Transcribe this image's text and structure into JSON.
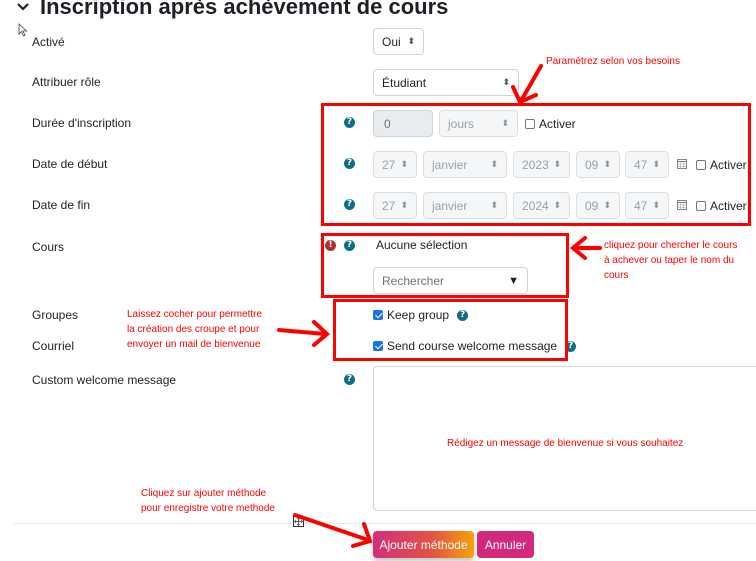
{
  "section": {
    "title": "Inscription après achèvement de cours",
    "collapse_icon": "chevron-down-icon"
  },
  "fields": {
    "enabled": {
      "label": "Activé",
      "value": "Oui"
    },
    "role": {
      "label": "Attribuer rôle",
      "value": "Étudiant"
    },
    "duration": {
      "label": "Durée d'inscription",
      "value": "0",
      "unit": "jours",
      "enable_label": "Activer",
      "enabled": false
    },
    "start_date": {
      "label": "Date de début",
      "day": "27",
      "month": "janvier",
      "year": "2023",
      "hour": "09",
      "minute": "47",
      "enable_label": "Activer",
      "enabled": false
    },
    "end_date": {
      "label": "Date de fin",
      "day": "27",
      "month": "janvier",
      "year": "2024",
      "hour": "09",
      "minute": "47",
      "enable_label": "Activer",
      "enabled": false
    },
    "course": {
      "label": "Cours",
      "selection": "Aucune sélection",
      "search_placeholder": "Rechercher",
      "required": true
    },
    "groups": {
      "label": "Groupes",
      "checkbox_label": "Keep group",
      "checked": true
    },
    "email": {
      "label": "Courriel",
      "checkbox_label": "Send course welcome message",
      "checked": true
    },
    "custom_message": {
      "label": "Custom welcome message",
      "value": ""
    }
  },
  "buttons": {
    "submit": "Ajouter méthode",
    "cancel": "Annuler"
  },
  "annotations": {
    "settings": "Paramétrez selon vos besoins",
    "course_line1": "cliquez pour chercher le cours",
    "course_line2": "à achever ou taper le nom du",
    "course_line3": "cours",
    "groups_line1": "Laissez cocher pour permettre",
    "groups_line2": "la création des croupe et pour",
    "groups_line3": "envoyer un mail de bienvenue",
    "message": "Rédigez un message de bienvenue si vous souhaitez",
    "submit_line1": "Cliquez sur ajouter méthode",
    "submit_line2": "pour enregistre votre methode"
  },
  "colors": {
    "help_icon": "#0f6e84",
    "error_icon": "#b32e2e",
    "annotation": "#ff0000",
    "primary_button_start": "#d22e7e",
    "primary_button_end": "#f7a20b",
    "cancel_button": "#d2297f"
  }
}
